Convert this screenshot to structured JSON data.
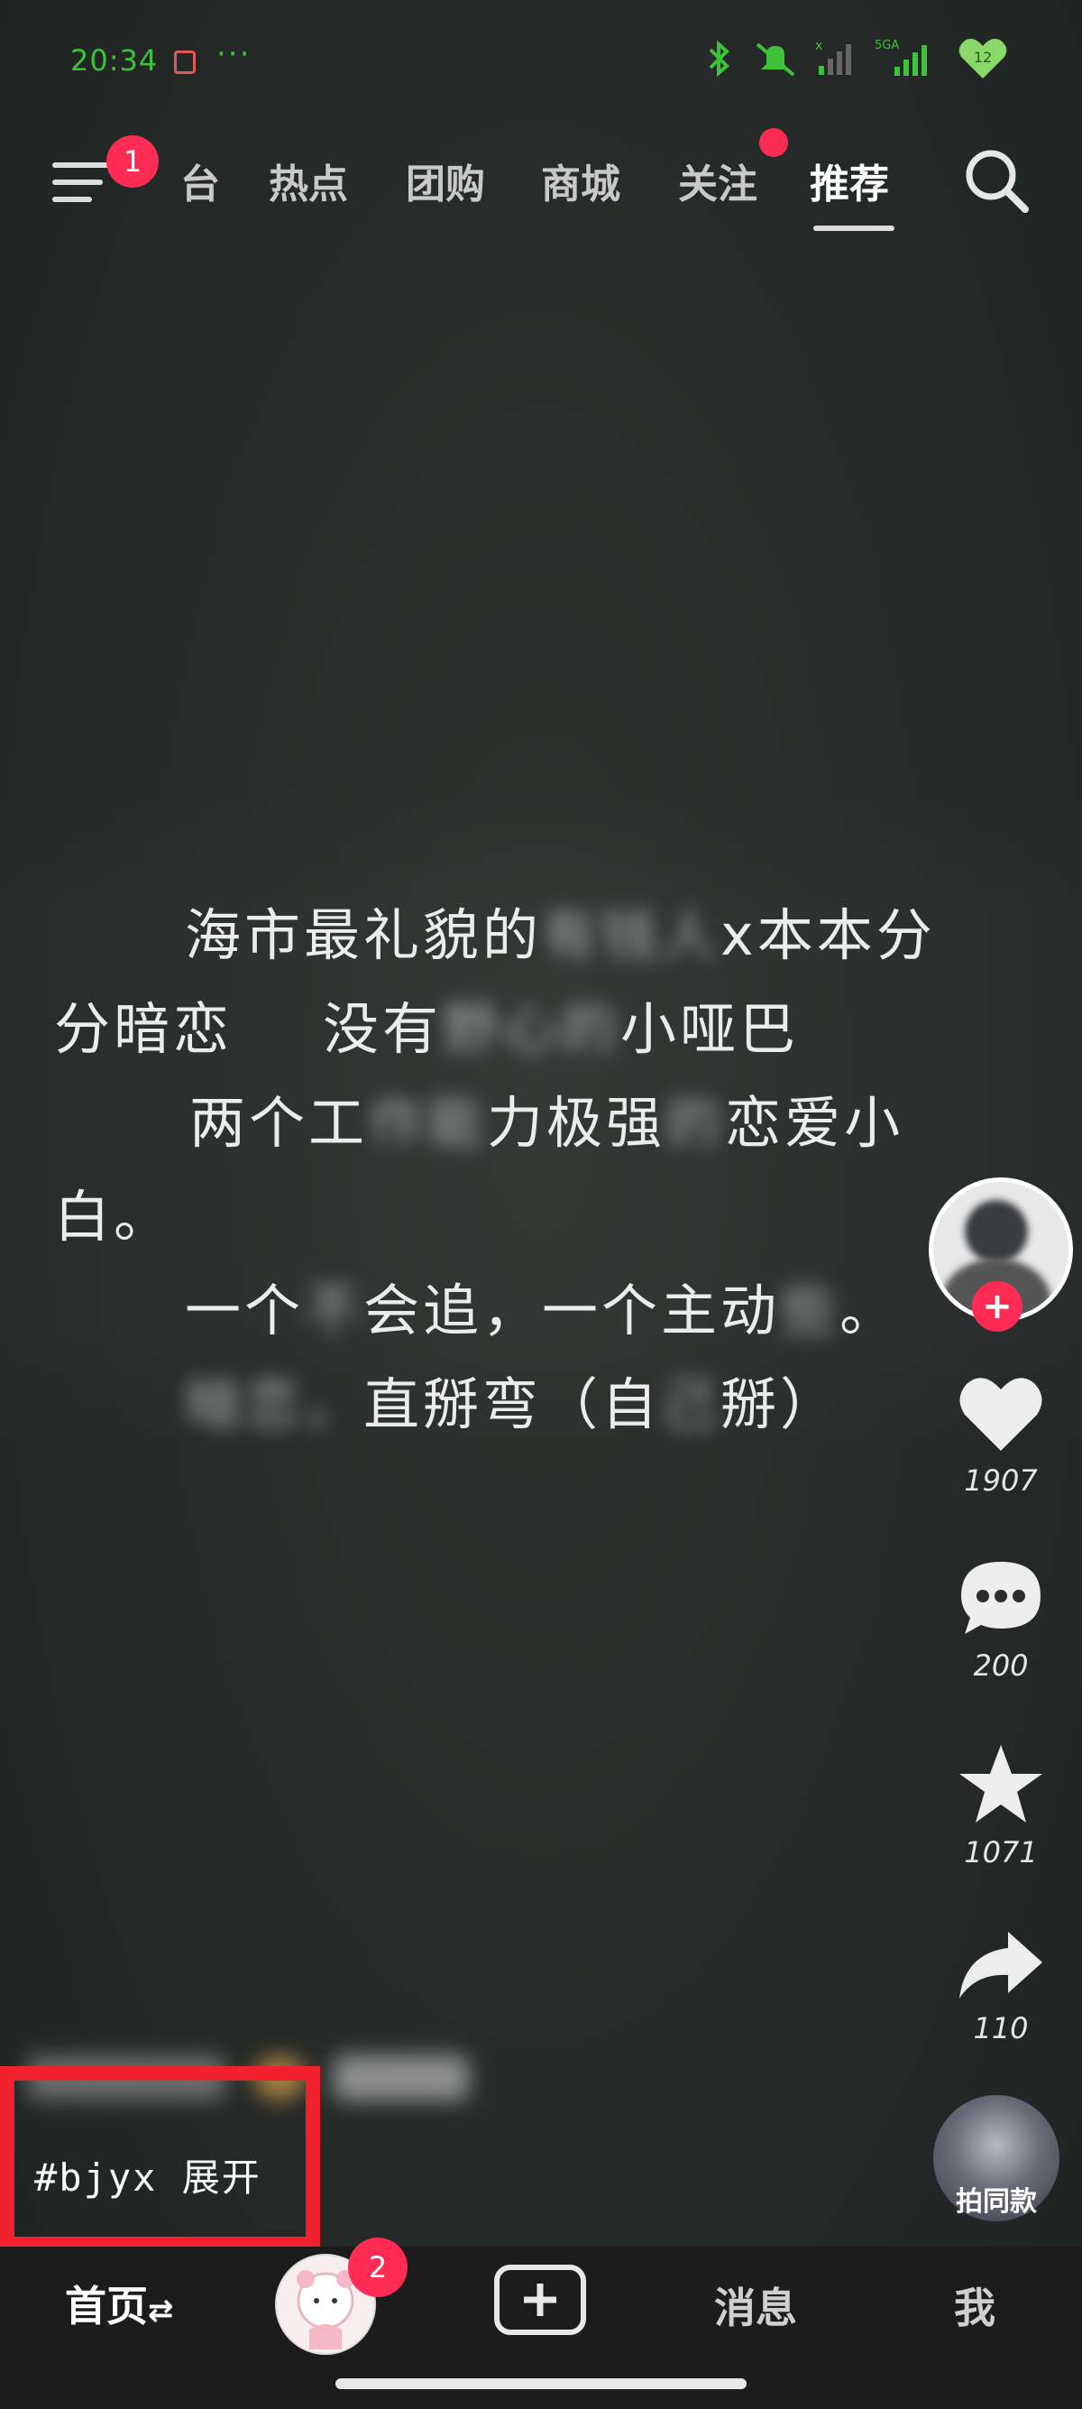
{
  "status_bar": {
    "time": "20:34",
    "dots": "···",
    "network_label": "5GA",
    "battery_level": "12"
  },
  "top_nav": {
    "menu_badge": "1",
    "tabs": [
      {
        "label": "台",
        "active": false
      },
      {
        "label": "热点",
        "active": false
      },
      {
        "label": "团购",
        "active": false
      },
      {
        "label": "商城",
        "active": false
      },
      {
        "label": "关注",
        "active": false
      },
      {
        "label": "推荐",
        "active": true
      }
    ]
  },
  "video_text": {
    "line1": "海市最礼貌的",
    "line1_blur": "有钱人",
    "line1_b": "x本本分",
    "line2": "分暗恋",
    "line2_b": "没有",
    "line2_blur": "野心的",
    "line2_c": "小哑巴",
    "line3": "两个工",
    "line3_blur": "作能",
    "line3_b": "力极强",
    "line3_blur2": "的",
    "line3_c": "恋爱小",
    "line4": "白。",
    "line5": "一个",
    "line5_blur": "不",
    "line5_b": "会追，一个主动",
    "line5_blur2": "些",
    "line5_c": "。",
    "line6_blur": "暗恋，",
    "line6": "直掰弯（自",
    "line6_blur2": "己",
    "line6_b": "掰）"
  },
  "right_rail": {
    "likes": "1907",
    "comments": "200",
    "favorites": "1071",
    "shares": "110",
    "music_label": "拍同款"
  },
  "caption": {
    "text": "#bjyx 展开"
  },
  "bottom_nav": {
    "home": "首页",
    "home_suffix": "⇄",
    "profile_badge": "2",
    "messages": "消息",
    "me": "我"
  },
  "colors": {
    "accent": "#fe2c55",
    "status_green": "#3ec23a",
    "highlight_box": "#f0202d"
  }
}
